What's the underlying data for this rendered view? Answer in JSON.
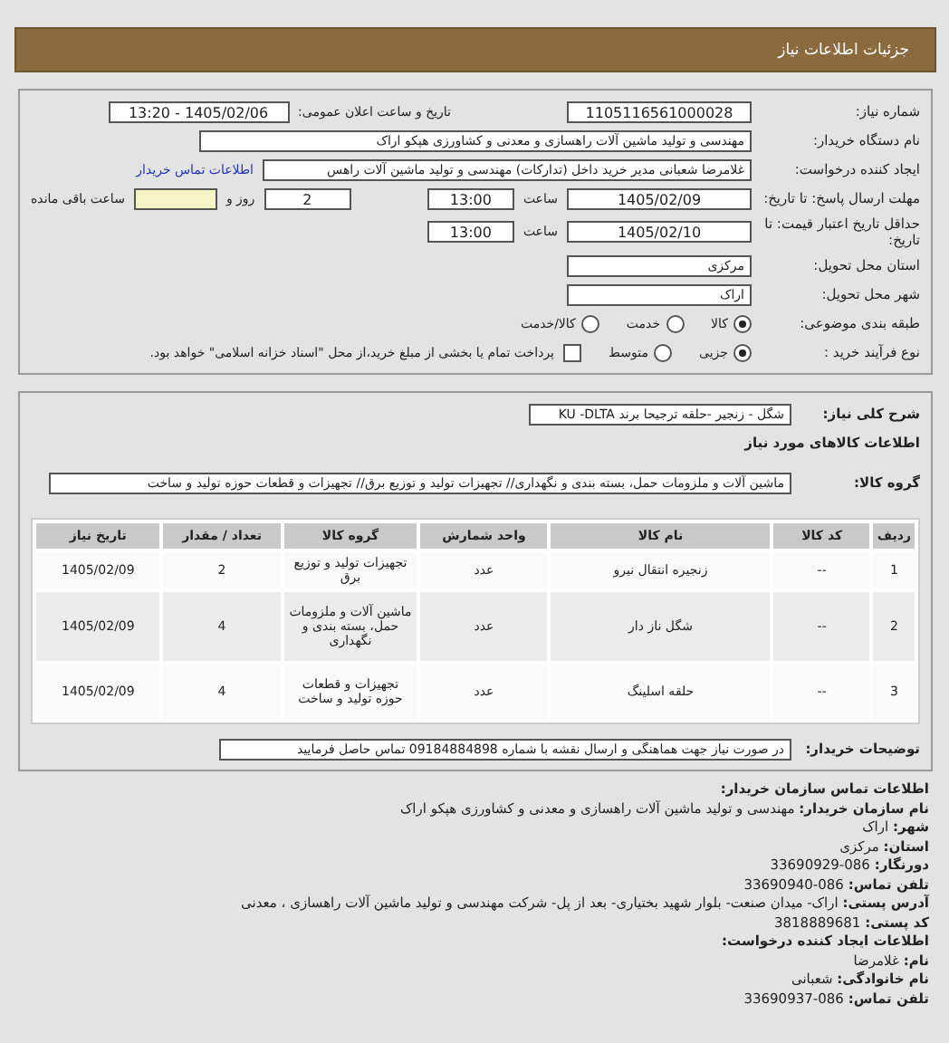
{
  "header": {
    "title": "جزئیات اطلاعات نیاز"
  },
  "need_number": {
    "label": "شماره نیاز:",
    "value": "1105116561000028"
  },
  "announce": {
    "label": "تاریخ و ساعت اعلان عمومی:",
    "value": "1405/02/06 - 13:20"
  },
  "buyer": {
    "label": "نام دستگاه خریدار:",
    "value": "مهندسی و تولید ماشین آلات راهسازی و معدنی و کشاورزی هپکو اراک"
  },
  "requester": {
    "label": "ایجاد کننده درخواست:",
    "value": "غلامرضا شعبانی مدیر خرید داخل (تدارکات) مهندسی و تولید ماشین آلات راهس",
    "link": "اطلاعات تماس خریدار"
  },
  "deadline": {
    "label": "مهلت ارسال پاسخ: تا تاریخ:",
    "date": "1405/02/09",
    "time_label": "ساعت",
    "time": "13:00",
    "days": "2",
    "days_label": "روز و",
    "remaining_label": "ساعت باقی مانده"
  },
  "validity": {
    "label": "حداقل تاریخ اعتبار قیمت: تا تاریخ:",
    "date": "1405/02/10",
    "time_label": "ساعت",
    "time": "13:00"
  },
  "province": {
    "label": "استان محل تحویل:",
    "value": "مرکزی"
  },
  "city": {
    "label": "شهر محل تحویل:",
    "value": "اراک"
  },
  "category": {
    "label": "طبقه بندی موضوعی:",
    "options": [
      {
        "label": "کالا",
        "selected": true
      },
      {
        "label": "خدمت",
        "selected": false
      },
      {
        "label": "کالا/خدمت",
        "selected": false
      }
    ]
  },
  "purchase_type": {
    "label": "نوع فرآیند خرید :",
    "options": [
      {
        "label": "جزیی",
        "selected": true
      },
      {
        "label": "متوسط",
        "selected": false
      }
    ],
    "payment": {
      "checked": false,
      "text": "پرداخت تمام یا بخشی از مبلغ خرید،از محل \"اسناد خزانه اسلامی\" خواهد بود."
    }
  },
  "summary": {
    "label": "شرح کلی نیاز:",
    "value": "شگل - زنجیر -حلقه ترجیحا برند KU -DLTA"
  },
  "goods_heading": "اطلاعات کالاهای مورد نیاز",
  "goods_group": {
    "label": "گروه کالا:",
    "value": "ماشین آلات و ملزومات حمل، بسته بندی و نگهداری// تجهیزات تولید و توزیع برق// تجهیزات و قطعات حوزه تولید و ساخت"
  },
  "table": {
    "columns": [
      "ردیف",
      "کد کالا",
      "نام کالا",
      "واحد شمارش",
      "گروه کالا",
      "تعداد / مقدار",
      "تاریخ نیاز"
    ],
    "rows": [
      [
        "1",
        "--",
        "زنجیره انتقال نیرو",
        "عدد",
        "تجهیزات تولید و توزیع برق",
        "2",
        "1405/02/09"
      ],
      [
        "2",
        "--",
        "شگل ناز دار",
        "عدد",
        "ماشین آلات و ملزومات حمل، بسته بندی و نگهداری",
        "4",
        "1405/02/09"
      ],
      [
        "3",
        "--",
        "حلقه اسلینگ",
        "عدد",
        "تجهیزات و قطعات حوزه تولید و ساخت",
        "4",
        "1405/02/09"
      ]
    ]
  },
  "buyer_notes": {
    "label": "توضیحات خریدار:",
    "value": "در صورت نیاز جهت هماهنگی و ارسال نقشه با شماره 09184884898 تماس حاصل فرمایید"
  },
  "contact": [
    {
      "kind": "heading",
      "label": "اطلاعات تماس سازمان خریدار:"
    },
    {
      "kind": "pair",
      "label": "نام سازمان خریدار:",
      "value": "مهندسی و تولید ماشین آلات راهسازی و معدنی و کشاورزی هپکو اراک"
    },
    {
      "kind": "pair",
      "label": "شهر:",
      "value": "اراک"
    },
    {
      "kind": "pair",
      "label": "استان:",
      "value": "مرکزی"
    },
    {
      "kind": "pair",
      "label": "دورنگار:",
      "value": "086-33690929"
    },
    {
      "kind": "pair",
      "label": "تلفن تماس:",
      "value": "086-33690940"
    },
    {
      "kind": "pair",
      "label": "آدرس پستی:",
      "value": "اراک- میدان صنعت- بلوار شهید بختیاری- بعد از پل- شرکت مهندسی و تولید ماشین آلات راهسازی ، معدنی"
    },
    {
      "kind": "pair",
      "label": "کد پستی:",
      "value": "3818889681"
    },
    {
      "kind": "heading",
      "label": "اطلاعات ایجاد کننده درخواست:"
    },
    {
      "kind": "pair",
      "label": "نام:",
      "value": "غلامرضا"
    },
    {
      "kind": "pair",
      "label": "نام خانوادگی:",
      "value": "شعبانی"
    },
    {
      "kind": "pair",
      "label": "تلفن تماس:",
      "value": "086-33690937"
    }
  ]
}
